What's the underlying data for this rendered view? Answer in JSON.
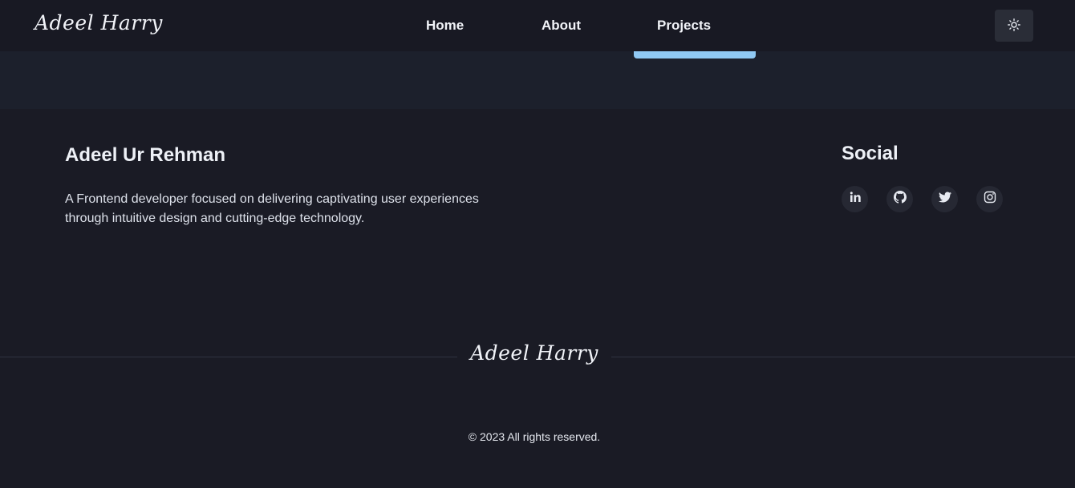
{
  "navbar": {
    "brand": "Adeel Harry",
    "links": [
      {
        "label": "Home"
      },
      {
        "label": "About"
      },
      {
        "label": "Projects"
      }
    ],
    "theme_toggle_icon": "sun-icon"
  },
  "footer": {
    "name": "Adeel Ur Rehman",
    "description": "A Frontend developer focused on delivering captivating user experiences through intuitive design and cutting-edge technology.",
    "social": {
      "title": "Social",
      "icons": [
        "linkedin-icon",
        "github-icon",
        "twitter-icon",
        "instagram-icon"
      ]
    },
    "brand": "Adeel Harry",
    "copyright": "© 2023 All rights reserved."
  },
  "colors": {
    "background": "#1a1b25",
    "navbar": "#181923",
    "strip": "#1c202c",
    "accent": "#90c9f4"
  }
}
